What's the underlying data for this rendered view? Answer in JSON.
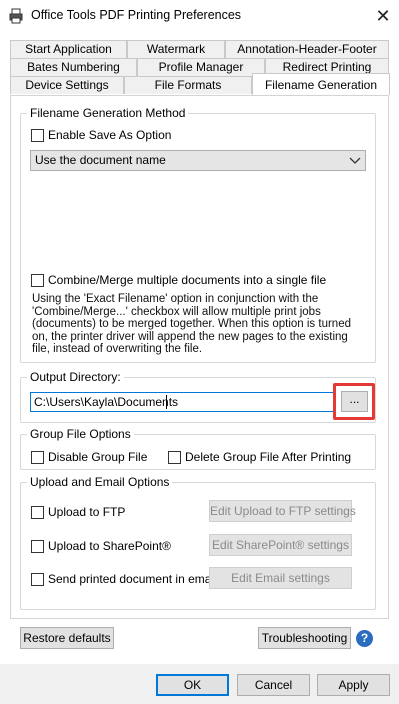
{
  "window": {
    "title": "Office Tools PDF Printing Preferences",
    "close_label": "✕"
  },
  "tabs": {
    "row1": [
      "Start Application",
      "Watermark",
      "Annotation-Header-Footer"
    ],
    "row2": [
      "Bates Numbering",
      "Profile Manager",
      "Redirect Printing"
    ],
    "row3": [
      "Device Settings",
      "File Formats",
      "Filename Generation"
    ],
    "active": "Filename Generation"
  },
  "filename_generation": {
    "group_title": "Filename Generation Method",
    "enable_save_as_label": "Enable Save As Option",
    "enable_save_as_checked": false,
    "method_selected": "Use the document name",
    "combine_label": "Combine/Merge multiple documents into a single file",
    "combine_checked": false,
    "description": "Using the 'Exact Filename' option in conjunction with the 'Combine/Merge...' checkbox will allow multiple print jobs (documents) to be merged together. When this option is turned on, the printer driver will append the new pages to the existing file, instead of overwriting the file."
  },
  "output_directory": {
    "group_title": "Output Directory:",
    "path": "C:\\Users\\Kayla\\Documents",
    "browse_label": "..."
  },
  "group_file_options": {
    "group_title": "Group File Options",
    "disable_label": "Disable Group File",
    "delete_label": "Delete Group File After Printing"
  },
  "upload_email": {
    "group_title": "Upload and Email Options",
    "ftp_label": "Upload to FTP",
    "ftp_settings_label": "Edit Upload to FTP settings",
    "sharepoint_label": "Upload to SharePoint®",
    "sharepoint_settings_label": "Edit SharePoint® settings",
    "email_label": "Send printed document in email",
    "email_settings_label": "Edit Email settings"
  },
  "bottom": {
    "restore_label": "Restore defaults",
    "troubleshooting_label": "Troubleshooting",
    "help_label": "?"
  },
  "footer": {
    "ok_label": "OK",
    "cancel_label": "Cancel",
    "apply_label": "Apply"
  },
  "colors": {
    "accent": "#0078d7",
    "highlight": "#e53935",
    "help_icon": "#2a6cc0"
  }
}
